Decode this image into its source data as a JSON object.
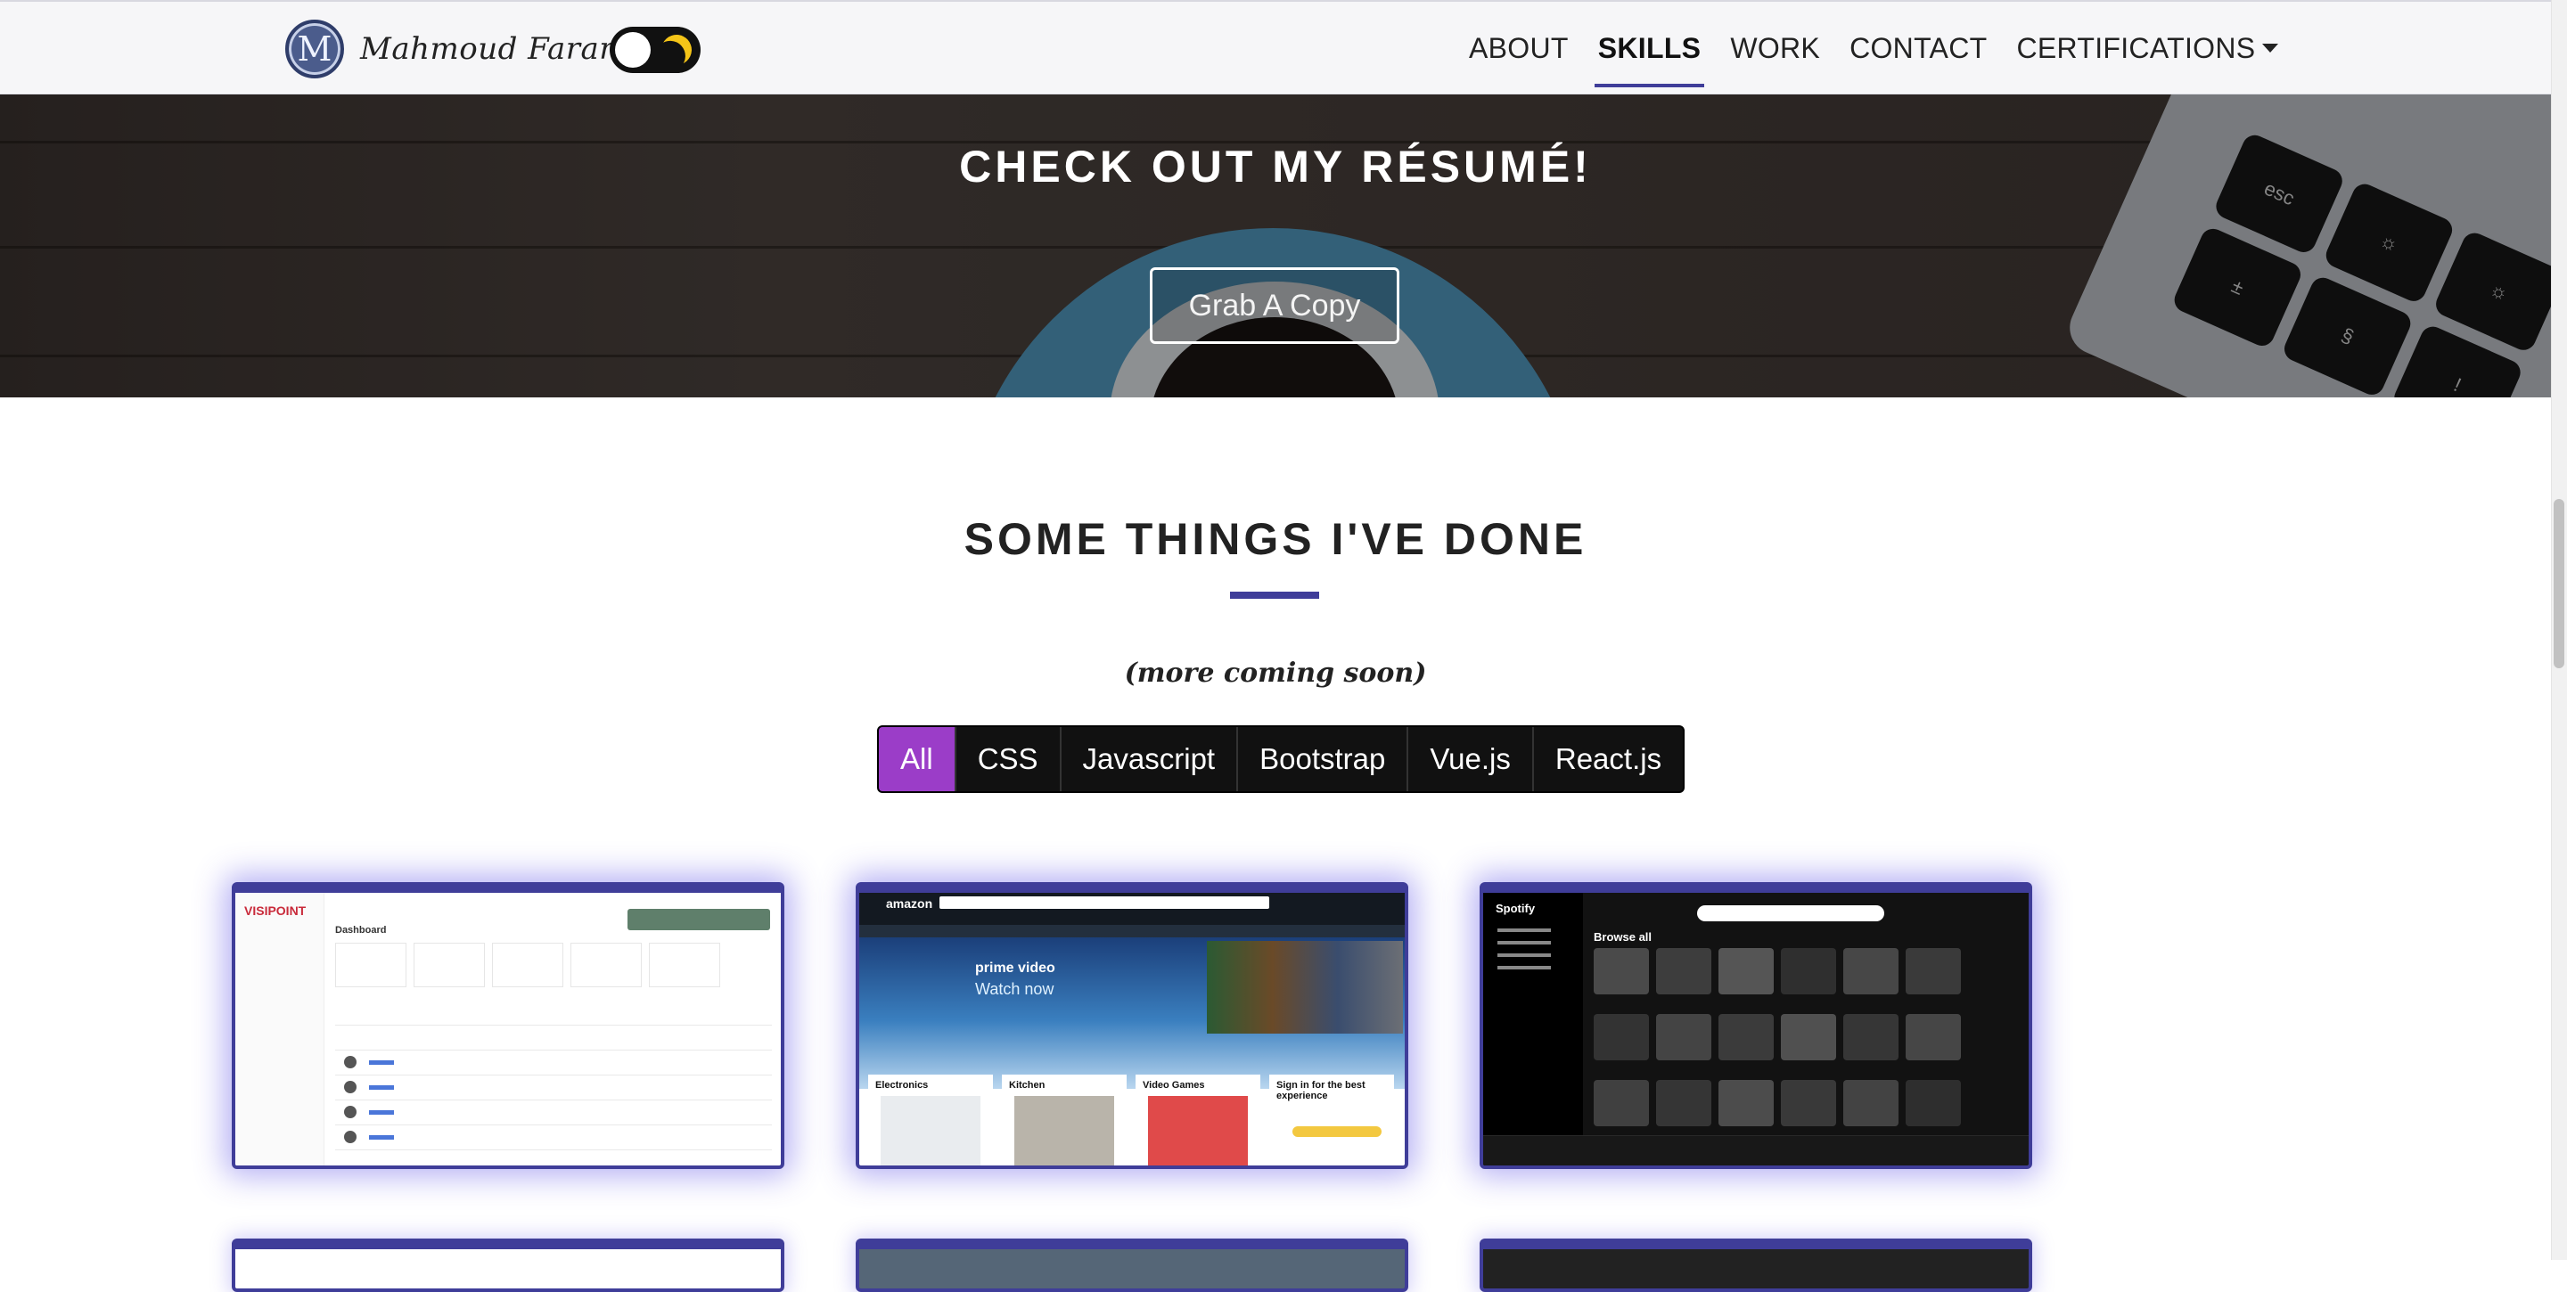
{
  "navbar": {
    "avatar_letter": "M",
    "brand_name": "Mahmoud Farargy",
    "links": [
      {
        "label": "ABOUT"
      },
      {
        "label": "SKILLS"
      },
      {
        "label": "WORK"
      },
      {
        "label": "CONTACT"
      },
      {
        "label": "CERTIFICATIONS"
      }
    ],
    "active_link": "SKILLS"
  },
  "hero": {
    "title": "CHECK OUT MY RÉSUMÉ!",
    "button_label": "Grab A Copy",
    "keys": [
      "esc",
      "☼",
      "☼",
      "±",
      "§",
      "!"
    ]
  },
  "projects": {
    "title": "SOME THINGS I'VE DONE",
    "subtitle": "(more coming soon)",
    "filters": [
      {
        "label": "All"
      },
      {
        "label": "CSS"
      },
      {
        "label": "Javascript"
      },
      {
        "label": "Bootstrap"
      },
      {
        "label": "Vue.js"
      },
      {
        "label": "React.js"
      }
    ],
    "active_filter": "All",
    "cards": {
      "visipoint": {
        "logo": "VISIPOINT",
        "heading": "Dashboard"
      },
      "amazon": {
        "logo": "amazon",
        "promo_brand": "prime video",
        "promo_text": "Watch now",
        "tiles": [
          "Electronics",
          "Kitchen",
          "Video Games",
          "Sign in for the best experience"
        ]
      },
      "spotify": {
        "logo": "Spotify",
        "heading": "Browse all"
      }
    }
  },
  "colors": {
    "accent": "#3f3d99",
    "filter_active": "#9b3dc8",
    "moon": "#f5c518"
  }
}
